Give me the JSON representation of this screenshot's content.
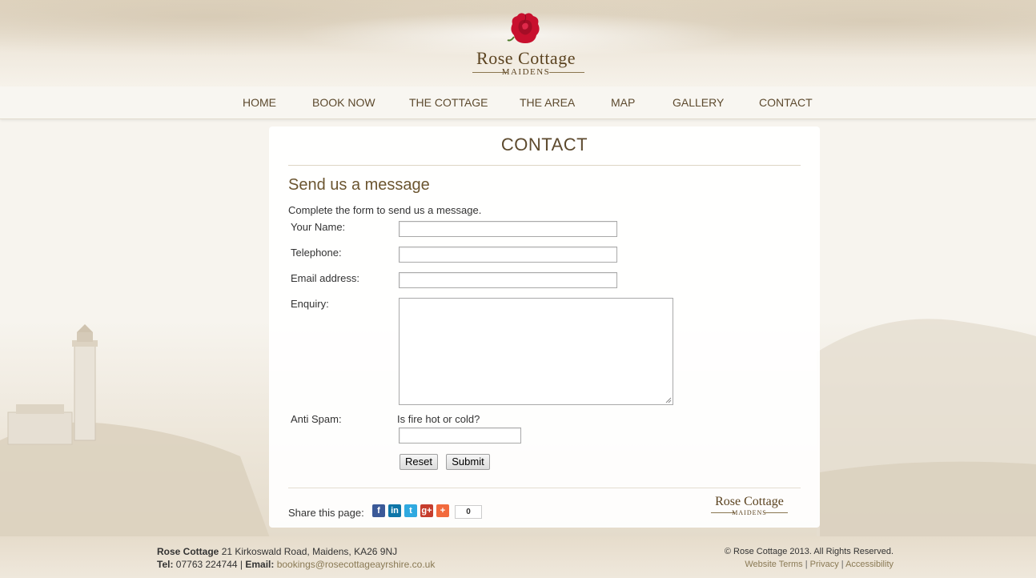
{
  "brand": {
    "name": "Rose Cottage",
    "location": "Maidens"
  },
  "nav": [
    "HOME",
    "BOOK NOW",
    "THE COTTAGE",
    "THE AREA",
    "MAP",
    "GALLERY",
    "CONTACT"
  ],
  "page": {
    "title": "CONTACT",
    "section_title": "Send us a message",
    "intro": "Complete the form to send us a message."
  },
  "form": {
    "name_label": "Your Name:",
    "telephone_label": "Telephone:",
    "email_label": "Email address:",
    "enquiry_label": "Enquiry:",
    "antispam_label": "Anti Spam:",
    "antispam_question": "Is fire hot or cold?",
    "name_value": "",
    "telephone_value": "",
    "email_value": "",
    "enquiry_value": "",
    "antispam_value": "",
    "reset_label": "Reset",
    "submit_label": "Submit"
  },
  "share": {
    "label": "Share this page:",
    "icons": [
      "facebook-icon",
      "linkedin-icon",
      "twitter-icon",
      "google-plus-icon",
      "addthis-icon"
    ],
    "count": "0"
  },
  "footer": {
    "business_name": "Rose Cottage",
    "address": "21 Kirkoswald Road, Maidens, KA26 9NJ",
    "tel_label": "Tel:",
    "tel": "07763 224744",
    "email_label": "Email:",
    "email": "bookings@rosecottageayrshire.co.uk",
    "copyright": "© Rose Cottage 2013. All Rights Reserved.",
    "links": [
      "Website Terms",
      "Privacy",
      "Accessibility"
    ]
  },
  "colors": {
    "accent": "#5d4a2e",
    "rose": "#c8102e",
    "link": "#8a7a55"
  }
}
